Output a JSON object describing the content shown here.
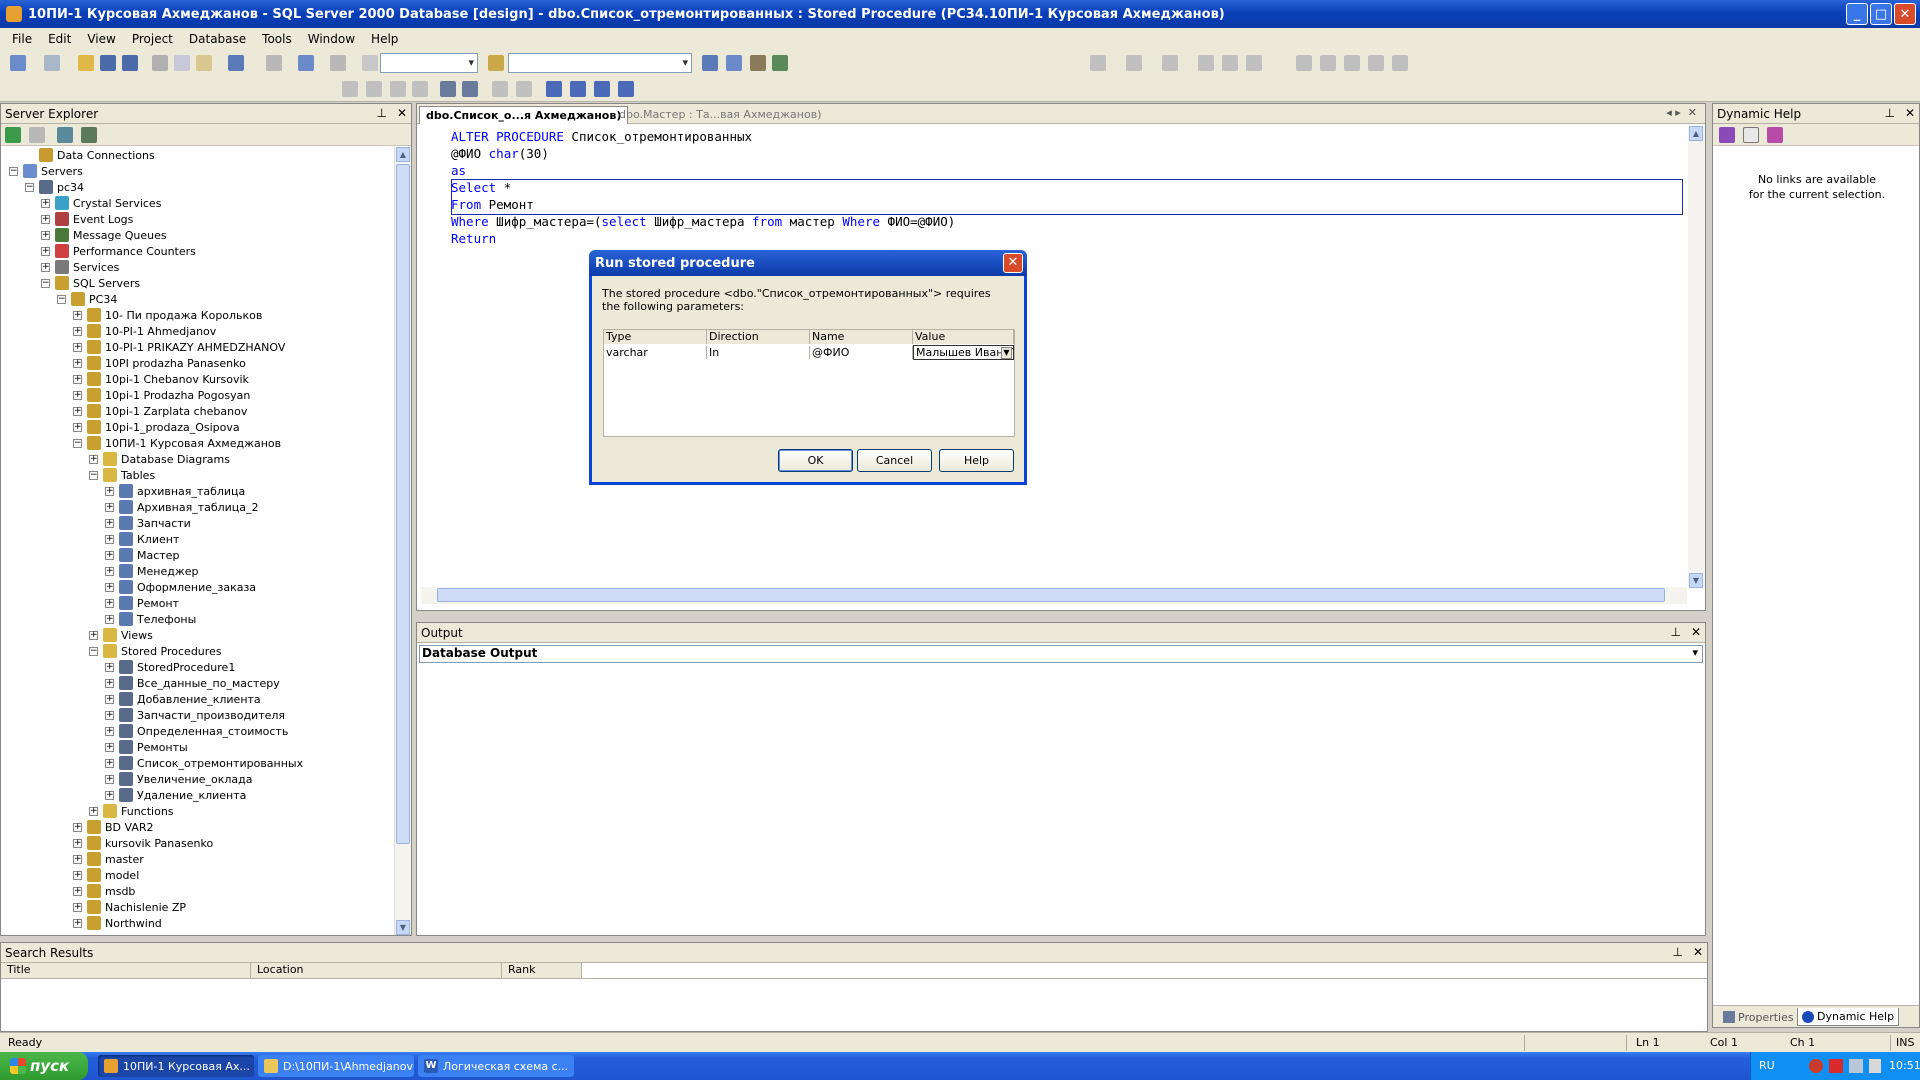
{
  "window": {
    "title": "10ПИ-1 Курсовая Ахмеджанов - SQL Server 2000 Database [design] - dbo.Список_отремонтированных : Stored Procedure (PC34.10ПИ-1 Курсовая Ахмеджанов)"
  },
  "menu": [
    "File",
    "Edit",
    "View",
    "Project",
    "Database",
    "Tools",
    "Window",
    "Help"
  ],
  "server_explorer": {
    "title": "Server Explorer",
    "tree": [
      {
        "label": "Data Connections",
        "indent": 1,
        "exp": "",
        "color": "#c89a30"
      },
      {
        "label": "Servers",
        "indent": 0,
        "exp": "−",
        "color": "#6b8ccf"
      },
      {
        "label": "pc34",
        "indent": 1,
        "exp": "−",
        "color": "#5a6a8a"
      },
      {
        "label": "Crystal Services",
        "indent": 2,
        "exp": "+",
        "color": "#3aa0c8"
      },
      {
        "label": "Event Logs",
        "indent": 2,
        "exp": "+",
        "color": "#b04040"
      },
      {
        "label": "Message Queues",
        "indent": 2,
        "exp": "+",
        "color": "#4a7a3a"
      },
      {
        "label": "Performance Counters",
        "indent": 2,
        "exp": "+",
        "color": "#d04040"
      },
      {
        "label": "Services",
        "indent": 2,
        "exp": "+",
        "color": "#7a7a7a"
      },
      {
        "label": "SQL Servers",
        "indent": 2,
        "exp": "−",
        "color": "#c8a030"
      },
      {
        "label": "PC34",
        "indent": 3,
        "exp": "−",
        "color": "#c8a030"
      },
      {
        "label": "10- Пи продажа Корольков",
        "indent": 4,
        "exp": "+",
        "color": "#c8a030"
      },
      {
        "label": "10-PI-1 Ahmedjanov",
        "indent": 4,
        "exp": "+",
        "color": "#c8a030"
      },
      {
        "label": "10-PI-1 PRIKAZY AHMEDZHANOV",
        "indent": 4,
        "exp": "+",
        "color": "#c8a030"
      },
      {
        "label": "10PI prodazha Panasenko",
        "indent": 4,
        "exp": "+",
        "color": "#c8a030"
      },
      {
        "label": "10pi-1 Chebanov Kursovik",
        "indent": 4,
        "exp": "+",
        "color": "#c8a030"
      },
      {
        "label": "10pi-1 Prodazha Pogosyan",
        "indent": 4,
        "exp": "+",
        "color": "#c8a030"
      },
      {
        "label": "10pi-1 Zarplata chebanov",
        "indent": 4,
        "exp": "+",
        "color": "#c8a030"
      },
      {
        "label": "10pi-1_prodaza_Osipova",
        "indent": 4,
        "exp": "+",
        "color": "#c8a030"
      },
      {
        "label": "10ПИ-1 Курсовая Ахмеджанов",
        "indent": 4,
        "exp": "−",
        "color": "#c8a030"
      },
      {
        "label": "Database Diagrams",
        "indent": 5,
        "exp": "+",
        "color": "#d8b840"
      },
      {
        "label": "Tables",
        "indent": 5,
        "exp": "−",
        "color": "#d8b840"
      },
      {
        "label": "архивная_таблица",
        "indent": 6,
        "exp": "+",
        "color": "#5a7ab0"
      },
      {
        "label": "Архивная_таблица_2",
        "indent": 6,
        "exp": "+",
        "color": "#5a7ab0"
      },
      {
        "label": "Запчасти",
        "indent": 6,
        "exp": "+",
        "color": "#5a7ab0"
      },
      {
        "label": "Клиент",
        "indent": 6,
        "exp": "+",
        "color": "#5a7ab0"
      },
      {
        "label": "Мастер",
        "indent": 6,
        "exp": "+",
        "color": "#5a7ab0"
      },
      {
        "label": "Менеджер",
        "indent": 6,
        "exp": "+",
        "color": "#5a7ab0"
      },
      {
        "label": "Оформление_заказа",
        "indent": 6,
        "exp": "+",
        "color": "#5a7ab0"
      },
      {
        "label": "Ремонт",
        "indent": 6,
        "exp": "+",
        "color": "#5a7ab0"
      },
      {
        "label": "Телефоны",
        "indent": 6,
        "exp": "+",
        "color": "#5a7ab0"
      },
      {
        "label": "Views",
        "indent": 5,
        "exp": "+",
        "color": "#d8b840"
      },
      {
        "label": "Stored Procedures",
        "indent": 5,
        "exp": "−",
        "color": "#d8b840"
      },
      {
        "label": "StoredProcedure1",
        "indent": 6,
        "exp": "+",
        "color": "#5a6a8a"
      },
      {
        "label": "Все_данные_по_мастеру",
        "indent": 6,
        "exp": "+",
        "color": "#5a6a8a"
      },
      {
        "label": "Добавление_клиента",
        "indent": 6,
        "exp": "+",
        "color": "#5a6a8a"
      },
      {
        "label": "Запчасти_производителя",
        "indent": 6,
        "exp": "+",
        "color": "#5a6a8a"
      },
      {
        "label": "Определенная_стоимость",
        "indent": 6,
        "exp": "+",
        "color": "#5a6a8a"
      },
      {
        "label": "Ремонты",
        "indent": 6,
        "exp": "+",
        "color": "#5a6a8a"
      },
      {
        "label": "Список_отремонтированных",
        "indent": 6,
        "exp": "+",
        "color": "#5a6a8a"
      },
      {
        "label": "Увеличение_оклада",
        "indent": 6,
        "exp": "+",
        "color": "#5a6a8a"
      },
      {
        "label": "Удаление_клиента",
        "indent": 6,
        "exp": "+",
        "color": "#5a6a8a"
      },
      {
        "label": "Functions",
        "indent": 5,
        "exp": "+",
        "color": "#d8b840"
      },
      {
        "label": "BD VAR2",
        "indent": 4,
        "exp": "+",
        "color": "#c8a030"
      },
      {
        "label": "kursovik Panasenko",
        "indent": 4,
        "exp": "+",
        "color": "#c8a030"
      },
      {
        "label": "master",
        "indent": 4,
        "exp": "+",
        "color": "#c8a030"
      },
      {
        "label": "model",
        "indent": 4,
        "exp": "+",
        "color": "#c8a030"
      },
      {
        "label": "msdb",
        "indent": 4,
        "exp": "+",
        "color": "#c8a030"
      },
      {
        "label": "Nachislenie ZP",
        "indent": 4,
        "exp": "+",
        "color": "#c8a030"
      },
      {
        "label": "Northwind",
        "indent": 4,
        "exp": "+",
        "color": "#c8a030"
      }
    ]
  },
  "editor": {
    "tabs": [
      "dbo.Список_о...я Ахмеджанов)",
      "dbo.Мастер : Та...вая Ахмеджанов)"
    ],
    "code": [
      [
        {
          "t": "ALTER PROCEDURE",
          "k": 1
        },
        {
          "t": " Список_отремонтированных",
          "k": 0
        }
      ],
      [
        {
          "t": "@ФИО ",
          "k": 0
        },
        {
          "t": "char",
          "k": 1
        },
        {
          "t": "(30)",
          "k": 0
        }
      ],
      [
        {
          "t": "as",
          "k": 1
        }
      ],
      [
        {
          "t": "Select",
          "k": 1
        },
        {
          "t": " *",
          "k": 0
        }
      ],
      [
        {
          "t": "From",
          "k": 1
        },
        {
          "t": " Ремонт",
          "k": 0
        }
      ],
      [
        {
          "t": "Where",
          "k": 1
        },
        {
          "t": " Шифр_мастера=(",
          "k": 0
        },
        {
          "t": "select",
          "k": 1
        },
        {
          "t": " Шифр_мастера ",
          "k": 0
        },
        {
          "t": "from",
          "k": 1
        },
        {
          "t": " мастер ",
          "k": 0
        },
        {
          "t": "Where",
          "k": 1
        },
        {
          "t": " ФИО=@ФИО)",
          "k": 0
        }
      ],
      [
        {
          "t": "Return",
          "k": 1
        }
      ]
    ]
  },
  "output": {
    "title": "Output",
    "pane": "Database Output"
  },
  "dynamic_help": {
    "title": "Dynamic Help",
    "message_line1": "No links are available",
    "message_line2": "for the current selection.",
    "tab_properties": "Properties",
    "tab_help": "Dynamic Help"
  },
  "search_results": {
    "title": "Search Results",
    "columns": [
      "Title",
      "Location",
      "Rank"
    ]
  },
  "statusbar": {
    "text": "Ready",
    "ln": "Ln 1",
    "col": "Col 1",
    "ch": "Ch 1",
    "ins": "INS"
  },
  "dialog": {
    "title": "Run stored procedure",
    "message": "The stored procedure <dbo.\"Список_отремонтированных\"> requires the following parameters:",
    "headers": [
      "Type",
      "Direction",
      "Name",
      "Value"
    ],
    "row": {
      "type": "varchar",
      "direction": "In",
      "name": "@ФИО",
      "value": "Малышев Иван Г"
    },
    "ok": "OK",
    "cancel": "Cancel",
    "help": "Help"
  },
  "taskbar": {
    "start": "пуск",
    "tasks": [
      "10ПИ-1 Курсовая Ах...",
      "D:\\10ПИ-1\\Ahmedjanov",
      "Логическая схема с..."
    ],
    "lang": "RU",
    "time": "10:51"
  },
  "colors": {
    "xp_blue": "#0b3aa8",
    "keyword": "#0000ff",
    "panel": "#ece9d8"
  }
}
